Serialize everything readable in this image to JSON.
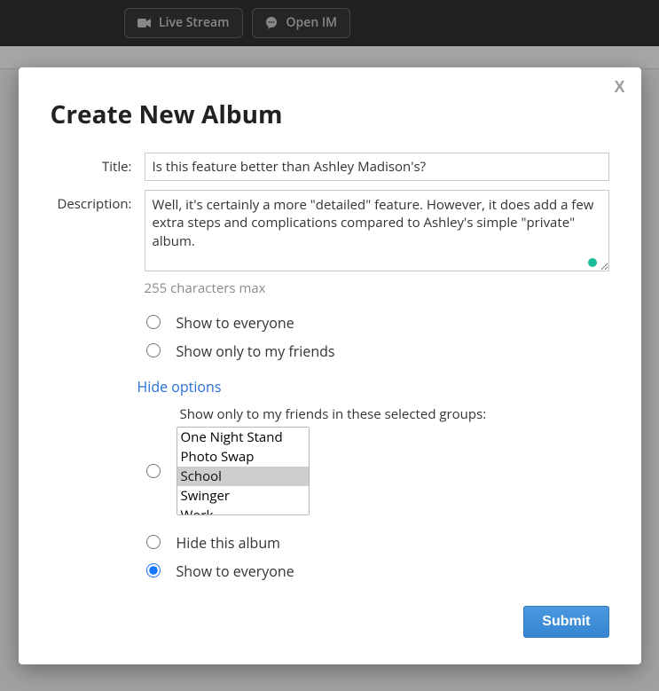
{
  "topbar": {
    "live_stream_label": "Live Stream",
    "open_im_label": "Open IM"
  },
  "modal": {
    "close_label": "X",
    "heading": "Create New Album",
    "title_label": "Title:",
    "title_value": "Is this feature better than Ashley Madison's?",
    "description_label": "Description:",
    "description_value": "Well, it's certainly a more \"detailed\" feature. However, it does add a few extra steps and complications compared to Ashley's simple \"private\" album. ",
    "description_hint": "255 characters max",
    "options": {
      "show_everyone_1": "Show to everyone",
      "show_friends": "Show only to my friends",
      "hide_options_link": "Hide options",
      "groups_caption": "Show only to my friends in these selected groups:",
      "groups": [
        "One Night Stand",
        "Photo Swap",
        "School",
        "Swinger",
        "Work"
      ],
      "groups_selected": "School",
      "hide_album": "Hide this album",
      "show_everyone_2": "Show to everyone",
      "selected": "show_everyone_2"
    },
    "submit_label": "Submit"
  }
}
